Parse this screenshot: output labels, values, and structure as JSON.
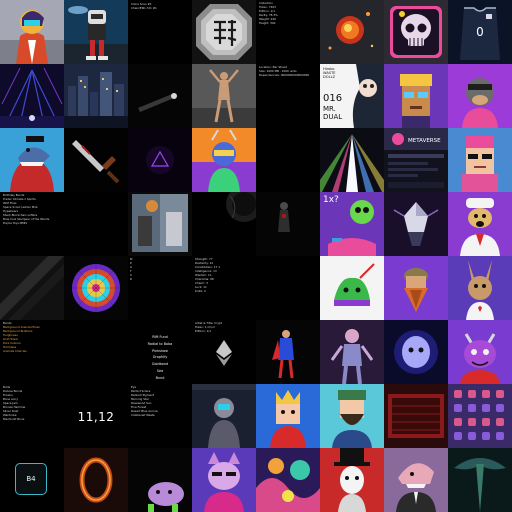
{
  "tiles": {
    "r0c2": {
      "lines": [
        "Clone Scan #1",
        "Chain/ERC-721 #1"
      ]
    },
    "r0c4": {
      "lines": [
        "Collection",
        "Token: 7403",
        "Edition: 1/1",
        "Rarity: 78.3%",
        "Weight: 240",
        "Height: 340"
      ]
    },
    "r1c4": {
      "lines": [
        "Location: Bar Street",
        "Size: 1000 MB - 1000 units",
        "Dependencies: 0000000000000000"
      ]
    },
    "r1c5": {
      "title_lines": [
        "Hiroko",
        "WASTE",
        "DOLLZ"
      ],
      "number": "016",
      "name_lines": [
        "MR.",
        "DUAL"
      ]
    },
    "r2c6": {
      "brand": "METAVERSE"
    },
    "r3c0": {
      "lines": [
        "Birthday Bonds",
        "Trader Climate x Spirits",
        "Wolf Fires",
        "Space Scout Ladder Mob",
        "Hypebears",
        "Stack Blockchain Lofters",
        "Blue Cool Skullpeer of the Woods",
        "Purple Toys MMIV"
      ]
    },
    "r3c5": {
      "label": "1x?"
    },
    "r4c2": {
      "label_lines": [
        "M",
        "P",
        "A",
        "T",
        "S",
        "R"
      ]
    },
    "r4c3": {
      "lines": [
        "Strength: 77",
        "Dexterity: 12",
        "Constitution: 17 1",
        "Intelligence: 13",
        "Wisdom: 11",
        "Charisma: 08",
        "Charm: 3",
        "Luck: 11",
        "Knife: 4"
      ]
    },
    "r5c0": {
      "lines": [
        "Bonds",
        "Background Grendel Elven",
        "Background Brothers",
        "Toughness",
        "Gold Silver",
        "Pure Colours",
        "Hardness",
        "Animals Cherries"
      ]
    },
    "r5c2": {
      "menu": [
        "RIM Fund",
        "Radial to Boba",
        "Pinkshaw",
        "Graphify",
        "Goldbond",
        "Sea",
        "Bnnd"
      ]
    },
    "r5c3": {
      "lines": [
        "Artist & Title: Crypt",
        "Token: 1 mind",
        "Edition: 1/1"
      ]
    },
    "r6c0": {
      "lines": [
        "Birds",
        "Deluxe Bonds",
        "Frowns",
        "Bone Ivory",
        "Space Jam",
        "Bronze Hammer",
        "Silver Dust",
        "Wardrobe",
        "Machinist Bone"
      ]
    },
    "r6c1": {
      "label": "11,12"
    },
    "r6c2": {
      "lines": [
        "Eye",
        "Perfect Sclera",
        "Radiant Pigment",
        "Morning Star",
        "Rosewood Sun",
        "Fine Forest",
        "Desert Blue Aurora",
        "Cobblenet Waste"
      ]
    },
    "r7c0": {
      "label": "B4"
    }
  },
  "colors": {
    "background": "#000000",
    "accent_teal": "#3ab7c9",
    "purple_bg": "#6b37b8",
    "pink_bg": "#e2539a"
  }
}
